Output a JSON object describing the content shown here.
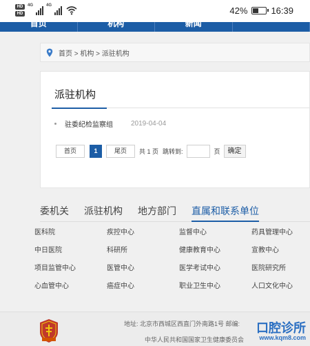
{
  "status_bar": {
    "hd1": "HD",
    "hd2": "HD",
    "net1": "4G",
    "net2": "4G",
    "battery": "42%",
    "battery_level": 0.42,
    "time": "16:39"
  },
  "top_nav": [
    "首页",
    "机构",
    "新闻",
    ""
  ],
  "breadcrumb": "首页 > 机构 > 派驻机构",
  "panel": {
    "title": "派驻机构",
    "items": [
      {
        "title": "驻委纪检监察组",
        "date": "2019-04-04"
      }
    ]
  },
  "pagination": {
    "first": "首页",
    "current": "1",
    "last": "尾页",
    "total": "共 1 页",
    "jump": "跳转到:",
    "page_unit": "页",
    "input_value": "",
    "confirm": "确定"
  },
  "tabs": {
    "items": [
      "委机关",
      "派驻机构",
      "地方部门",
      "直属和联系单位"
    ],
    "active": "直属和联系单位"
  },
  "links": [
    "医科院",
    "疾控中心",
    "监督中心",
    "药具管理中心",
    "中日医院",
    "科研所",
    "健康教育中心",
    "宣教中心",
    "项目监管中心",
    "医管中心",
    "医学考试中心",
    "医院研究所",
    "心血管中心",
    "癌症中心",
    "职业卫生中心",
    "人口文化中心"
  ],
  "footer": {
    "address": "地址: 北京市西城区西直门外南路1号    邮编:",
    "org": "中华人民共和国国家卫生健康委员会",
    "watermark": "口腔诊所",
    "watermark_url": "www.kqm8.com"
  },
  "colors": {
    "primary": "#1c5da6",
    "watermark": "#2b6fc2",
    "emblem": "#c0392b"
  }
}
